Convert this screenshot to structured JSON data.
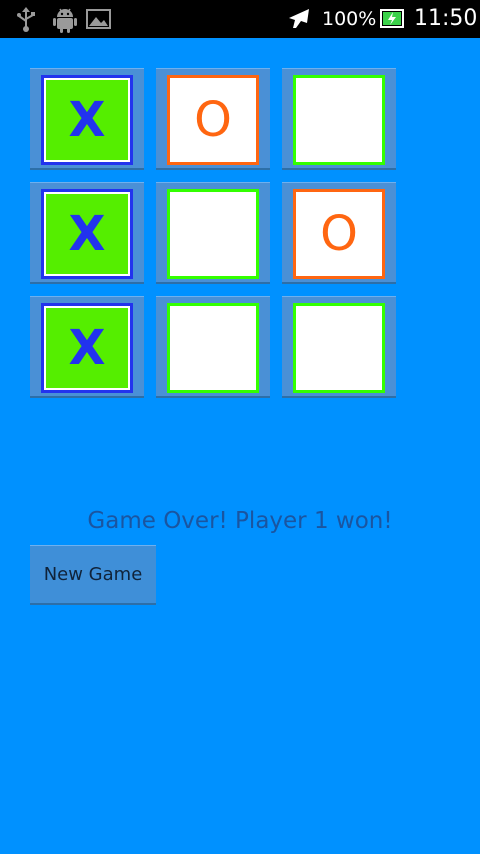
{
  "status_bar": {
    "battery_text": "100%",
    "time": "11:50",
    "icons": [
      "usb-icon",
      "android-debug-icon",
      "image-notification-icon",
      "airplane-mode-icon",
      "battery-charging-icon"
    ]
  },
  "board": {
    "cells": [
      {
        "mark": "X"
      },
      {
        "mark": "O"
      },
      {
        "mark": ""
      },
      {
        "mark": "X"
      },
      {
        "mark": ""
      },
      {
        "mark": "O"
      },
      {
        "mark": "X"
      },
      {
        "mark": ""
      },
      {
        "mark": ""
      }
    ]
  },
  "game": {
    "status_message": "Game Over! Player 1 won!",
    "new_game_label": "New Game"
  },
  "colors": {
    "background": "#0091ff",
    "x_mark": "#2233ee",
    "x_fill": "#55ee00",
    "o_mark": "#ff6611",
    "empty_border": "#33ff00"
  }
}
